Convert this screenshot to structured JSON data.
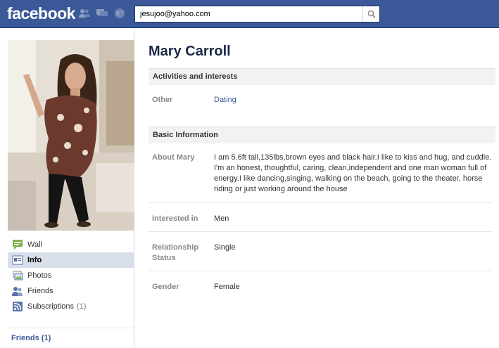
{
  "header": {
    "logo": "facebook",
    "search_value": "jesujoo@yahoo.com"
  },
  "nav": {
    "items": [
      {
        "label": "Wall",
        "icon": "wall-icon"
      },
      {
        "label": "Info",
        "icon": "info-icon"
      },
      {
        "label": "Photos",
        "icon": "photos-icon"
      },
      {
        "label": "Friends",
        "icon": "friends-icon"
      },
      {
        "label": "Subscriptions",
        "icon": "subscriptions-icon",
        "count": "(1)"
      }
    ],
    "friends_heading": "Friends (1)"
  },
  "profile": {
    "name": "Mary Carroll",
    "activities": {
      "heading": "Activities and interests",
      "other_label": "Other",
      "other_value": "Dating"
    },
    "basic": {
      "heading": "Basic Information",
      "about_label": "About Mary",
      "about_value": "I am 5.6ft tall,135lbs,brown eyes and black hair.I like to kiss and hug, and cuddle. I'm an honest, thoughtful, caring, clean,independent and one man woman full of energy.I like dancing,singing, walking on the beach, going to the theater, horse riding or just working around the house",
      "interested_label": "Interested in",
      "interested_value": "Men",
      "relationship_label": "Relationship Status",
      "relationship_value": "Single",
      "gender_label": "Gender",
      "gender_value": "Female"
    }
  },
  "colors": {
    "brand": "#3b5998",
    "nav_selected": "#d8dfea"
  }
}
